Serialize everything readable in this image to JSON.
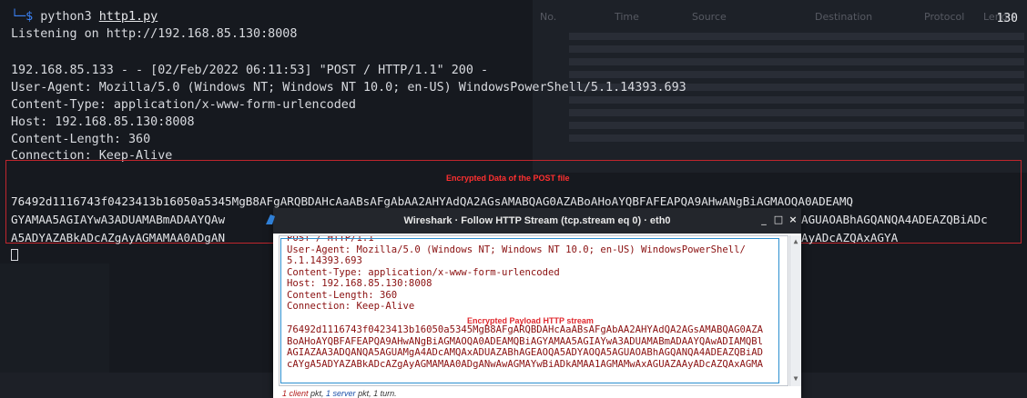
{
  "terminal": {
    "prompt_symbol": "└─$",
    "command": "python3",
    "command_file": "http1.py",
    "listening": "Listening on http://192.168.85.130:8008",
    "request_line": "192.168.85.133 - - [02/Feb/2022 06:11:53] \"POST / HTTP/1.1\" 200 -",
    "headers": [
      "User-Agent: Mozilla/5.0 (Windows NT; Windows NT 10.0; en-US) WindowsPowerShell/5.1.14393.693",
      "Content-Type: application/x-www-form-urlencoded",
      "Host: 192.168.85.130:8008",
      "Content-Length: 360",
      "Connection: Keep-Alive"
    ],
    "payload_lines": [
      "76492d1116743f0423413b16050a5345MgB8AFgARQBDAHcAaABsAFgAbAA2AHYAdQA2AGsAMABQAG0AZABoAHoAYQBFAFEAPQA9AHwANgBiAGMAOQA0ADEAMQ",
      "GYAMAA5AGIAYwA3ADUAMABmADAAYQAw",
      "A5ADYAZABkADcAZgAyAGMAMAA0ADgAN"
    ],
    "payload_tail_lines": [
      "AGUAOABhAGQANQA4ADEAZQBiADc",
      "AyADcAZQAxAGYA"
    ],
    "counter": "130"
  },
  "annotations": {
    "post_label": "Encrypted Data of the POST file",
    "stream_label": "Encrypted Payload HTTP stream"
  },
  "background_wireshark": {
    "columns": [
      "No.",
      "Time",
      "Source",
      "Destination",
      "Protocol",
      "Length"
    ]
  },
  "wireshark_window": {
    "title": "Wireshark · Follow HTTP Stream (tcp.stream eq 0) · eth0",
    "stream_lines": [
      "POST / HTTP/1.1",
      "User-Agent: Mozilla/5.0 (Windows NT; Windows NT 10.0; en-US) WindowsPowerShell/",
      "5.1.14393.693",
      "Content-Type: application/x-www-form-urlencoded",
      "Host: 192.168.85.130:8008",
      "Content-Length: 360",
      "Connection: Keep-Alive"
    ],
    "payload_lines": [
      "76492d1116743f0423413b16050a5345MgB8AFgARQBDAHcAaABsAFgAbAA2AHYAdQA2AGsAMABQAG0AZA",
      "BoAHoAYQBFAFEAPQA9AHwANgBiAGMAOQA0ADEAMQBiAGYAMAA5AGIAYwA3ADUAMABmADAAYQAwADIAMQBl",
      "AGIAZAA3ADQANQA5AGUAMgA4ADcAMQAxADUAZABhAGEAOQA5ADYAOQA5AGUAOABhAGQANQA4ADEAZQBiAD",
      "cAYgA5ADYAZABkADcAZgAyAGMAMAA0ADgANwAwAGMAYwBiADkAMAA1AGMAMwAxAGUAZAAyADcAZQAxAGMA"
    ],
    "status": {
      "client": "1 client",
      "pkt1": " pkt, ",
      "server": "1 server",
      "pkt2": " pkt, 1 turn."
    },
    "colors": {
      "request_text": "#8a1010",
      "highlight_box": "#2c8fd0",
      "annotation": "#e0282e"
    }
  }
}
